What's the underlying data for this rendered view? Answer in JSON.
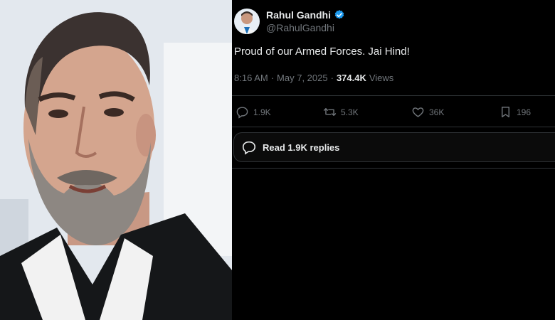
{
  "tweet": {
    "display_name": "Rahul Gandhi",
    "handle": "@RahulGandhi",
    "text": "Proud of our Armed Forces. Jai Hind!",
    "time": "8:16 AM",
    "separator": "·",
    "date": "May 7, 2025",
    "separator2": "·",
    "views_count": "374.4K",
    "views_label": "Views",
    "replies": "1.9K",
    "reposts": "5.3K",
    "likes": "36K",
    "bookmarks": "196",
    "read_replies": "Read 1.9K replies"
  },
  "colors": {
    "background": "#000000",
    "primary_text": "#e7e9ea",
    "secondary_text": "#71767b",
    "divider": "#2f3336",
    "verified": "#1d9bf0"
  },
  "icons": [
    "verified-badge-icon",
    "reply-icon",
    "repost-icon",
    "like-icon",
    "bookmark-icon",
    "speech-bubble-icon"
  ]
}
